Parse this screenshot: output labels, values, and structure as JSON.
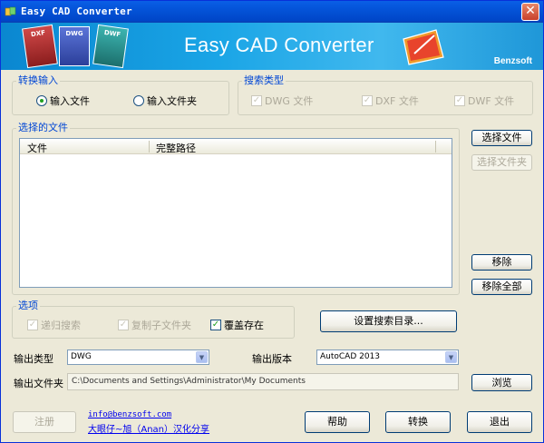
{
  "window": {
    "title": "Easy CAD Converter",
    "close": "✕"
  },
  "banner": {
    "title": "Easy CAD Converter",
    "brand": "Benzsoft",
    "doc_labels": [
      "DXF",
      "DWG",
      "DWF"
    ]
  },
  "input_group": {
    "label": "转换输入",
    "options": [
      {
        "label": "输入文件",
        "selected": true
      },
      {
        "label": "输入文件夹",
        "selected": false
      }
    ]
  },
  "search_type": {
    "label": "搜索类型",
    "items": [
      {
        "label": "DWG 文件",
        "checked": true
      },
      {
        "label": "DXF 文件",
        "checked": true
      },
      {
        "label": "DWF 文件",
        "checked": true
      }
    ]
  },
  "selected_files": {
    "label": "选择的文件",
    "columns": [
      "文件",
      "完整路径"
    ]
  },
  "buttons": {
    "select_file": "选择文件",
    "select_folder": "选择文件夹",
    "remove": "移除",
    "remove_all": "移除全部",
    "search_settings": "设置搜索目录...",
    "browse": "浏览",
    "register": "注册",
    "help": "帮助",
    "convert": "转换",
    "exit": "退出"
  },
  "options": {
    "label": "选项",
    "items": [
      {
        "label": "递归搜索",
        "checked": true
      },
      {
        "label": "复制子文件夹",
        "checked": true
      },
      {
        "label": "覆盖存在",
        "checked": true
      }
    ]
  },
  "output": {
    "type_label": "输出类型",
    "type_value": "DWG",
    "version_label": "输出版本",
    "version_value": "AutoCAD 2013",
    "folder_label": "输出文件夹",
    "folder_value": "C:\\Documents and Settings\\Administrator\\My Documents"
  },
  "links": {
    "email": "info@benzsoft.com",
    "credit": "大眼仔~旭（Anan）汉化分享"
  },
  "colors": {
    "group_label": "#0046d5",
    "titlebar": "#0453d8",
    "banner": "#1aa5e6"
  }
}
